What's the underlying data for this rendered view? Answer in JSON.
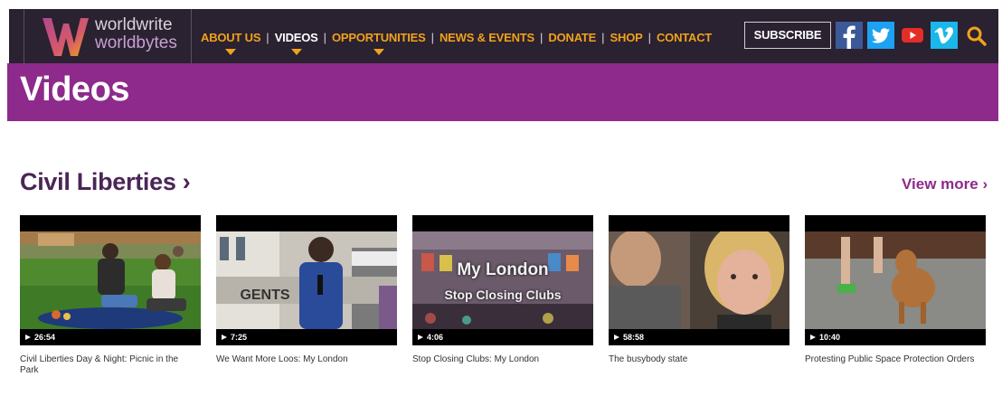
{
  "brand": {
    "line1": "worldwrite",
    "line2": "worldbytes",
    "colors": {
      "orange": "#f0a21a",
      "purple": "#8e2a8c",
      "navbar": "#2a2131"
    }
  },
  "nav": {
    "items": [
      {
        "label": "ABOUT US",
        "has_caret": true,
        "active": false
      },
      {
        "label": "VIDEOS",
        "has_caret": true,
        "active": true
      },
      {
        "label": "OPPORTUNITIES",
        "has_caret": true,
        "active": false
      },
      {
        "label": "NEWS & EVENTS",
        "has_caret": false,
        "active": false
      },
      {
        "label": "DONATE",
        "has_caret": false,
        "active": false
      },
      {
        "label": "SHOP",
        "has_caret": false,
        "active": false
      },
      {
        "label": "CONTACT",
        "has_caret": false,
        "active": false
      }
    ],
    "separator": "|",
    "subscribe_label": "SUBSCRIBE",
    "social": [
      "facebook-icon",
      "twitter-icon",
      "youtube-icon",
      "vimeo-icon"
    ],
    "search_icon": "search-icon"
  },
  "page": {
    "title": "Videos"
  },
  "section": {
    "title": "Civil Liberties ›",
    "view_more": "View more ›",
    "videos": [
      {
        "duration": "26:54",
        "title": "Civil Liberties Day & Night: Picnic in the Park"
      },
      {
        "duration": "7:25",
        "title": "We Want More Loos: My London",
        "thumb_text": "GENTS"
      },
      {
        "duration": "4:06",
        "title": "Stop Closing Clubs: My London",
        "thumb_text_1": "My London",
        "thumb_text_2": "Stop Closing Clubs"
      },
      {
        "duration": "58:58",
        "title": "The busybody state"
      },
      {
        "duration": "10:40",
        "title": "Protesting Public Space Protection Orders"
      }
    ]
  }
}
